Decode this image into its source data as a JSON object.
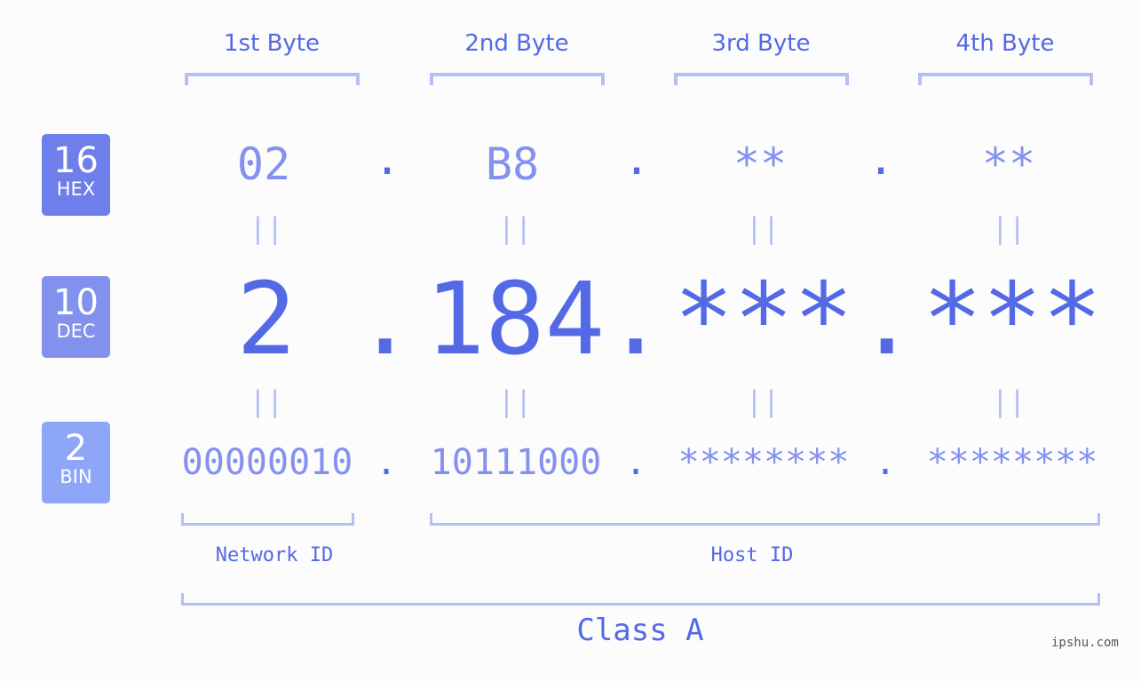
{
  "colors": {
    "accent": "#5469e6",
    "light_accent": "#8491ee",
    "bracket": "#b4bff6",
    "hex_badge": "#6e7feb",
    "dec_badge": "#8291ee",
    "bin_badge": "#8ea6f8",
    "background": "#fbfcfb"
  },
  "badges": [
    {
      "number": "16",
      "label": "HEX"
    },
    {
      "number": "10",
      "label": "DEC"
    },
    {
      "number": "2",
      "label": "BIN"
    }
  ],
  "bytes": [
    {
      "header": "1st Byte",
      "hex": "02",
      "dec": "2",
      "bin": "00000010"
    },
    {
      "header": "2nd Byte",
      "hex": "B8",
      "dec": "184",
      "bin": "10111000"
    },
    {
      "header": "3rd Byte",
      "hex": "**",
      "dec": "***",
      "bin": "********"
    },
    {
      "header": "4th Byte",
      "hex": "**",
      "dec": "***",
      "bin": "********"
    }
  ],
  "separator": ".",
  "equals": "||",
  "network_id_label": "Network ID",
  "host_id_label": "Host ID",
  "class_label": "Class A",
  "watermark": "ipshu.com"
}
